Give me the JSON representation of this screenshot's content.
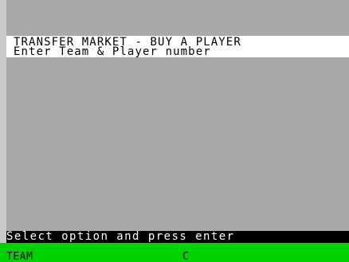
{
  "header": {
    "title": "TRANSFER MARKET - BUY A PLAYER",
    "subtitle": "Enter Team & Player number"
  },
  "prompt": {
    "text": "Select option and press enter"
  },
  "input": {
    "label": "TEAM",
    "cursor": "C"
  },
  "colors": {
    "border": "#c9c9c9",
    "main_bg": "#a9a9a9",
    "header_bg": "#ffffff",
    "prompt_bg": "#000000",
    "input_bg": "#00d300"
  }
}
